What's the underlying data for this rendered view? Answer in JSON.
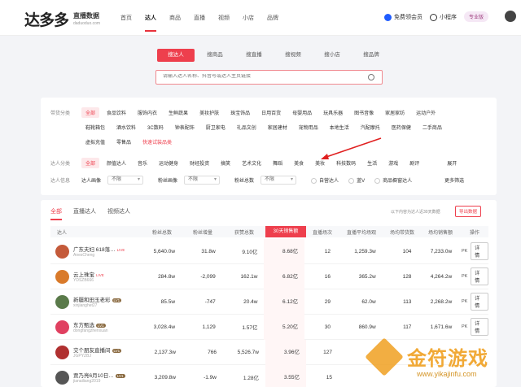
{
  "brand": {
    "logo": "达多多",
    "sub": "直播数据",
    "url": "daduoduo.com"
  },
  "nav": [
    "首页",
    "达人",
    "商品",
    "直播",
    "视频",
    "小店",
    "品牌"
  ],
  "header": {
    "vip": "免费领会员",
    "mini": "小程序",
    "pro": "专业版"
  },
  "search": {
    "tabs": [
      "搜达人",
      "搜商品",
      "搜直播",
      "搜视频",
      "搜小店",
      "搜品牌"
    ],
    "placeholder": "请输入达人名称、抖音号或达人主页链接"
  },
  "filters": {
    "category_label": "带货分类",
    "categories_row1": [
      "全部",
      "食品饮料",
      "服饰内衣",
      "生鲜蔬果",
      "美妆护肤",
      "珠宝饰品",
      "日用百货",
      "母婴用品",
      "玩具乐器",
      "图书音像",
      "家居家纺",
      "运动户外"
    ],
    "categories_row2": [
      "鞋靴箱包",
      "酒水饮料",
      "3C数码",
      "钟表配饰",
      "厨卫家电",
      "礼品文创",
      "家居建材",
      "宠物用品",
      "本地生活",
      "汽配摩托",
      "医药保健",
      "二手商品"
    ],
    "categories_row3": [
      "虚拟充值",
      "零售品"
    ],
    "categories_link": "快速试装品类",
    "type_label": "达人分类",
    "types": [
      "全部",
      "颜值达人",
      "音乐",
      "运动健身",
      "财经投资",
      "搞笑",
      "艺术文化",
      "舞蹈",
      "美食",
      "美妆",
      "科技数码",
      "生活",
      "游戏",
      "剧评"
    ],
    "types_more": "展开",
    "info_label": "达人信息",
    "info_fields": [
      {
        "label": "达人画像",
        "value": "不限"
      },
      {
        "label": "粉丝画像",
        "value": "不限"
      },
      {
        "label": "粉丝总数",
        "value": "不限"
      }
    ],
    "checks": [
      "自营达人",
      "蓝V",
      "商品橱窗达人"
    ],
    "more": "更多筛选"
  },
  "table": {
    "tabs": [
      "全部",
      "直播达人",
      "视频达人"
    ],
    "info": "以下内容为达人近30天数据",
    "export": "导出数据",
    "headers": [
      "达人",
      "粉丝总数",
      "粉丝增量",
      "获赞总数",
      "30天销售额",
      "直播场次",
      "直播平均场观",
      "场均带货数",
      "场均销售额",
      "操作"
    ],
    "rows": [
      {
        "name": "广东夫妇 618落…",
        "id": "AnesCheng",
        "badge": "LIVE",
        "fans": "5,640.0w",
        "inc": "31.8w",
        "likes": "9.10亿",
        "sales": "8.68亿",
        "lives": "12",
        "avg": "1,259.3w",
        "goods": "104",
        "avgsales": "7,233.0w",
        "color": "#c45a3a"
      },
      {
        "name": "云上珠宝",
        "id": "YDSZB666",
        "badge": "LIVE",
        "fans": "284.8w",
        "inc": "-2,099",
        "likes": "162.1w",
        "sales": "6.82亿",
        "lives": "16",
        "avg": "365.2w",
        "goods": "128",
        "avgsales": "4,264.2w",
        "color": "#d97a2a"
      },
      {
        "name": "新疆和田玉老彩",
        "id": "xinjianghet27",
        "badge": "LV1",
        "fans": "85.5w",
        "inc": "-747",
        "likes": "20.4w",
        "sales": "6.12亿",
        "lives": "29",
        "avg": "62.0w",
        "goods": "113",
        "avgsales": "2,268.2w",
        "color": "#5a7a4a"
      },
      {
        "name": "东方甄选",
        "id": "dongfangzhenxuan",
        "badge": "LV1",
        "fans": "3,028.4w",
        "inc": "1,129",
        "likes": "1.57亿",
        "sales": "5.20亿",
        "lives": "30",
        "avg": "860.9w",
        "goods": "117",
        "avgsales": "1,671.6w",
        "color": "#e04060"
      },
      {
        "name": "交个朋友直播间",
        "id": "JGPYZBJ",
        "badge": "LV1",
        "fans": "2,137.3w",
        "inc": "766",
        "likes": "5,526.7w",
        "sales": "3.96亿",
        "lives": "127",
        "avg": "",
        "goods": "",
        "avgsales": "",
        "color": "#b03030"
      },
      {
        "name": "贾乃亮6月10日…",
        "id": "jianailiang2019",
        "badge": "LV1",
        "fans": "3,209.8w",
        "inc": "-1.9w",
        "likes": "1.28亿",
        "sales": "3.55亿",
        "lives": "15",
        "avg": "",
        "goods": "",
        "avgsales": "",
        "color": "#555"
      }
    ],
    "pk": "PK",
    "detail": "详情"
  },
  "watermark": {
    "text": "金符游戏",
    "url": "www.yikajinfu.com"
  }
}
